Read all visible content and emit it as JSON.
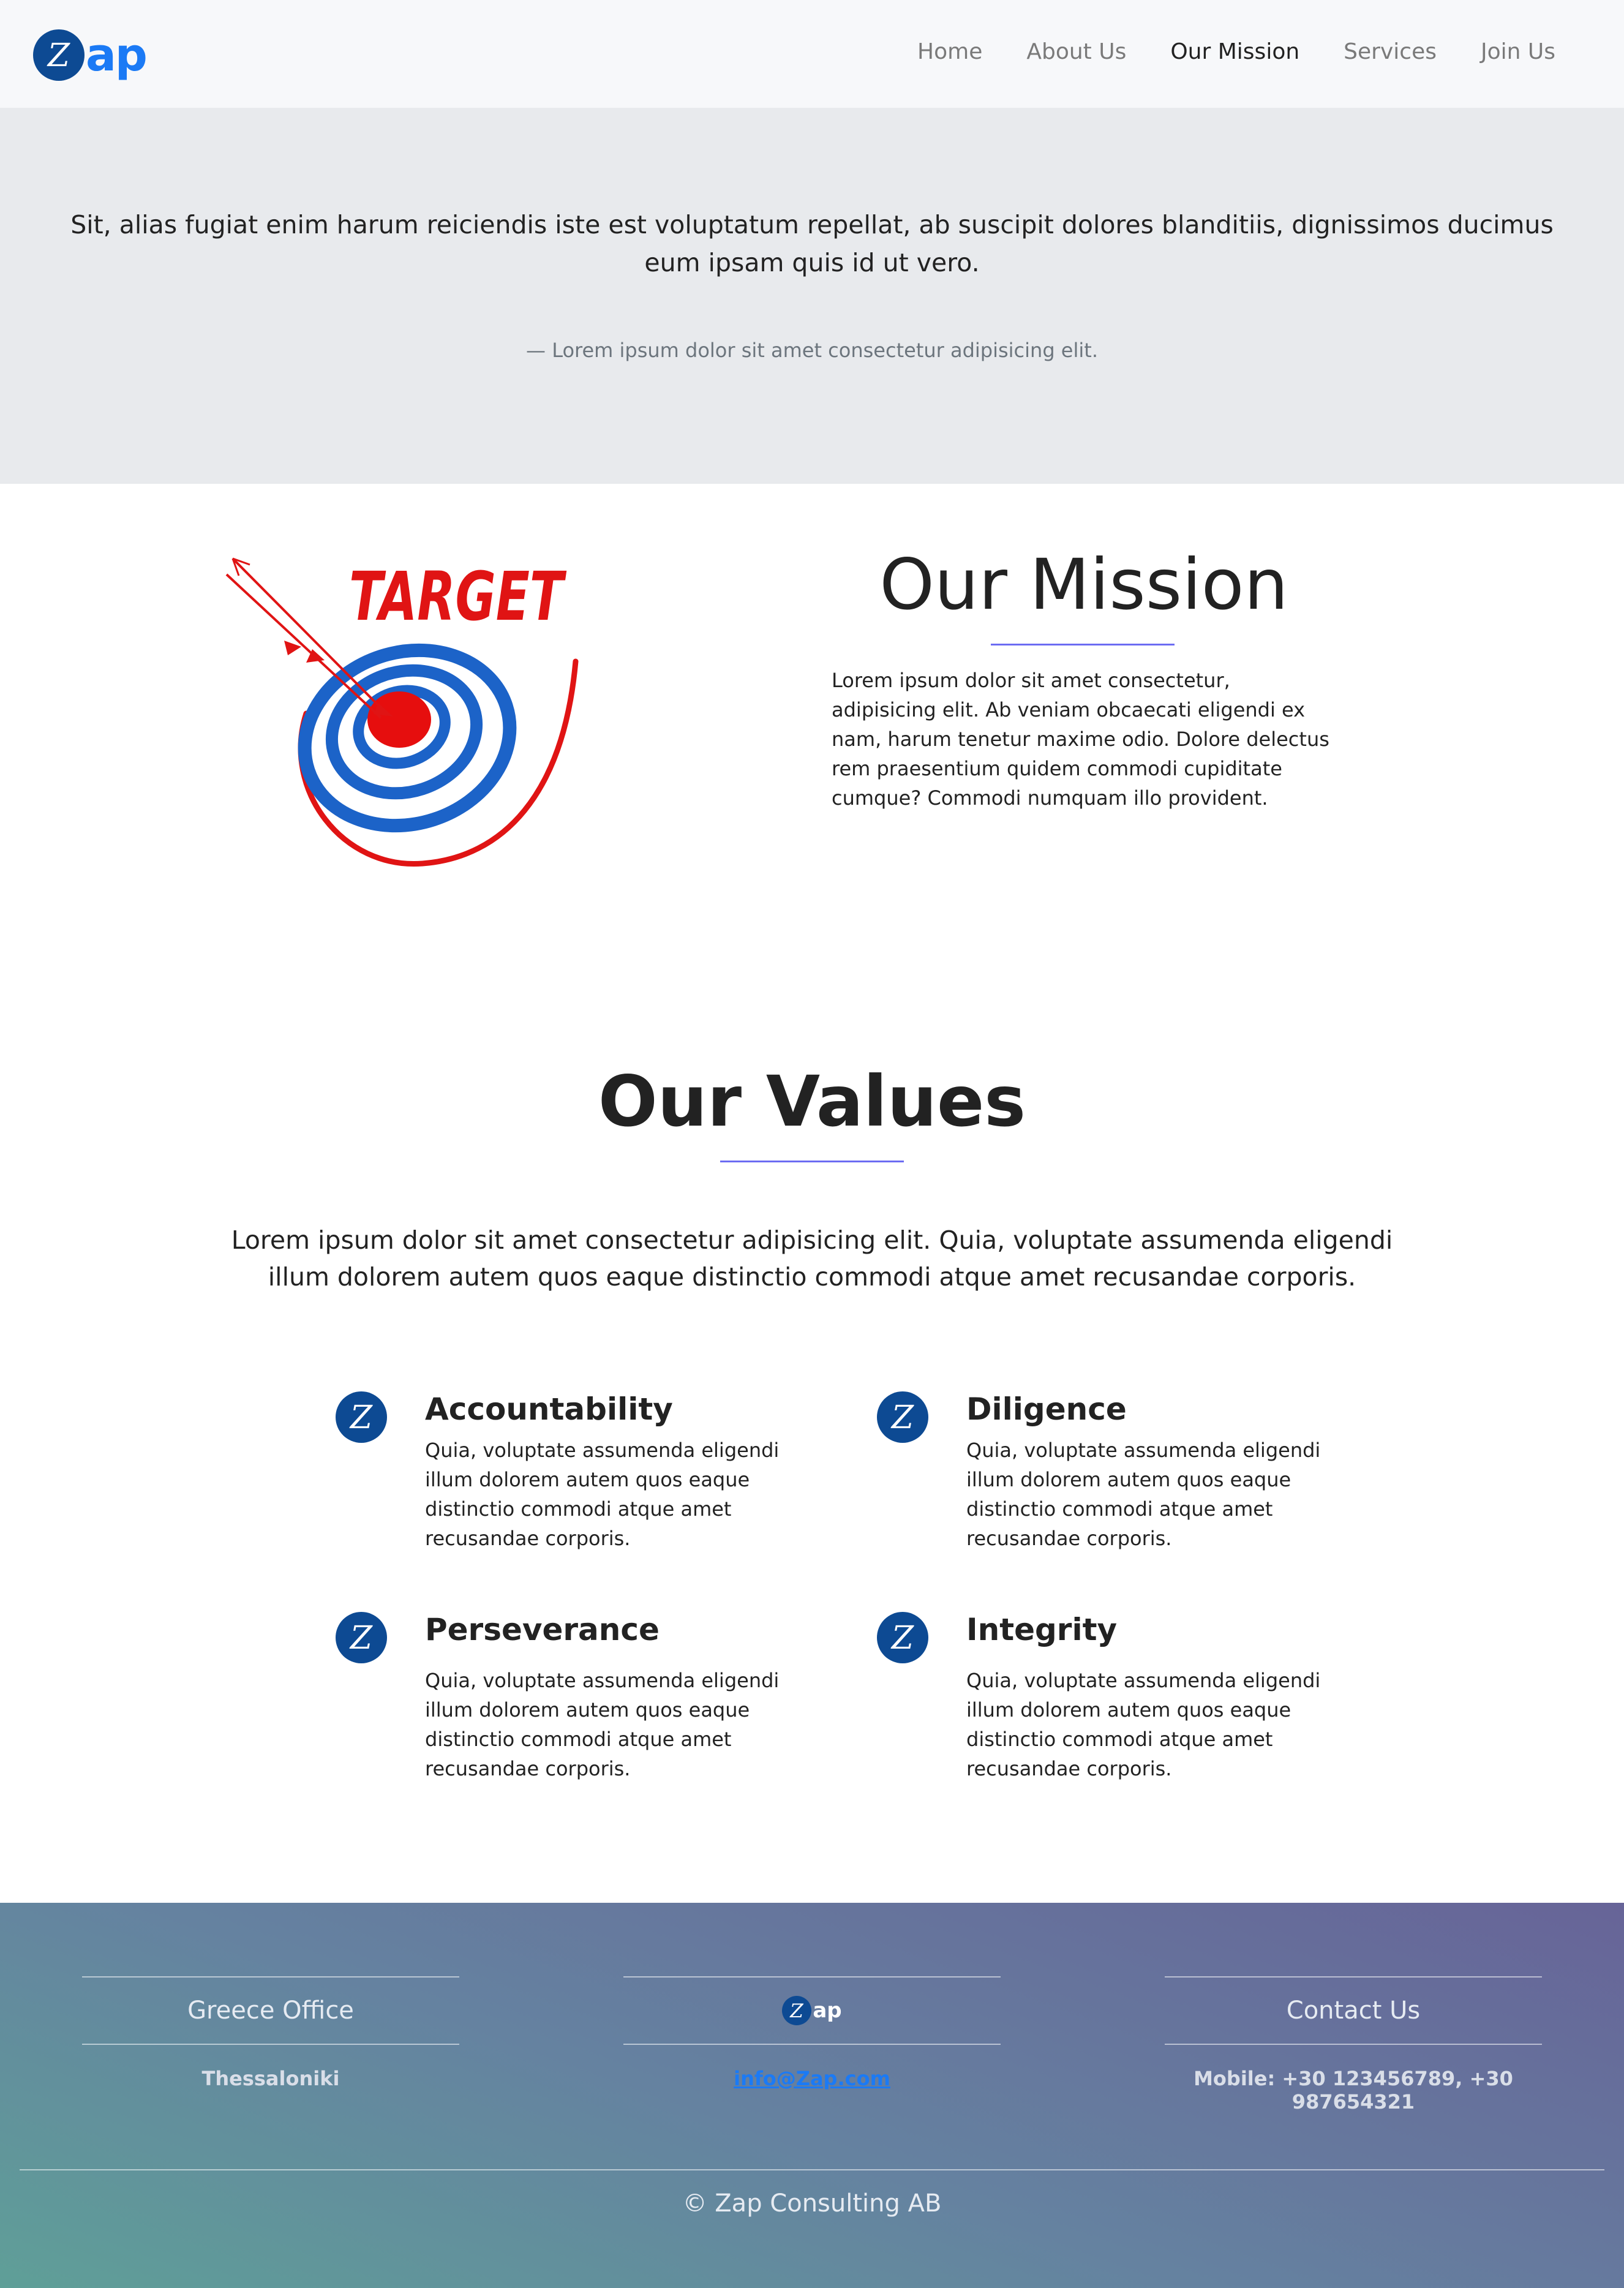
{
  "brand": {
    "logo_letter": "Z",
    "logo_rest": "ap",
    "logo_color": "#1b7af5",
    "logo_circle_color": "#0d4a93"
  },
  "nav": {
    "items": [
      {
        "label": "Home"
      },
      {
        "label": "About Us"
      },
      {
        "label": "Our Mission",
        "active": true
      },
      {
        "label": "Services"
      },
      {
        "label": "Join Us"
      }
    ]
  },
  "quote": {
    "text": "Sit, alias fugiat enim harum reiciendis iste est voluptatum repellat, ab suscipit dolores blanditiis, dignissimos ducimus eum ipsam quis id ut vero.",
    "cite": "— Lorem ipsum dolor sit amet consectetur adipisicing elit."
  },
  "mission": {
    "image_text": "TARGET",
    "title": "Our Mission",
    "text": "Lorem ipsum dolor sit amet consectetur, adipisicing elit. Ab veniam obcaecati eligendi ex nam, harum tenetur maxime odio. Dolore delectus rem praesentium quidem commodi cupiditate cumque? Commodi numquam illo provident."
  },
  "values": {
    "title": "Our Values",
    "intro": "Lorem ipsum dolor sit amet consectetur adipisicing elit. Quia, voluptate assumenda eligendi illum dolorem autem quos eaque distinctio commodi atque amet recusandae corporis.",
    "items": [
      {
        "title": "Accountability",
        "desc": "Quia, voluptate assumenda eligendi illum dolorem autem quos eaque distinctio commodi atque amet recusandae corporis."
      },
      {
        "title": "Diligence",
        "desc": "Quia, voluptate assumenda eligendi illum dolorem autem quos eaque distinctio commodi atque amet recusandae corporis."
      },
      {
        "title": "Perseverance",
        "desc": "Quia, voluptate assumenda eligendi illum dolorem autem quos eaque distinctio commodi atque amet recusandae corporis."
      },
      {
        "title": "Integrity",
        "desc": "Quia, voluptate assumenda eligendi illum dolorem autem quos eaque distinctio commodi atque amet recusandae corporis."
      }
    ]
  },
  "footer": {
    "office": {
      "heading": "Greece Office",
      "value": "Thessaloniki"
    },
    "center": {
      "email": "info@Zap.com"
    },
    "contact": {
      "heading": "Contact Us",
      "value": "Mobile: +30 123456789, +30 987654321"
    },
    "copyright": "© Zap Consulting AB"
  },
  "colors": {
    "accent_rule": "#6c6cf2",
    "quote_band_bg": "#e8eaed",
    "navbar_bg": "#f7f8fa"
  }
}
